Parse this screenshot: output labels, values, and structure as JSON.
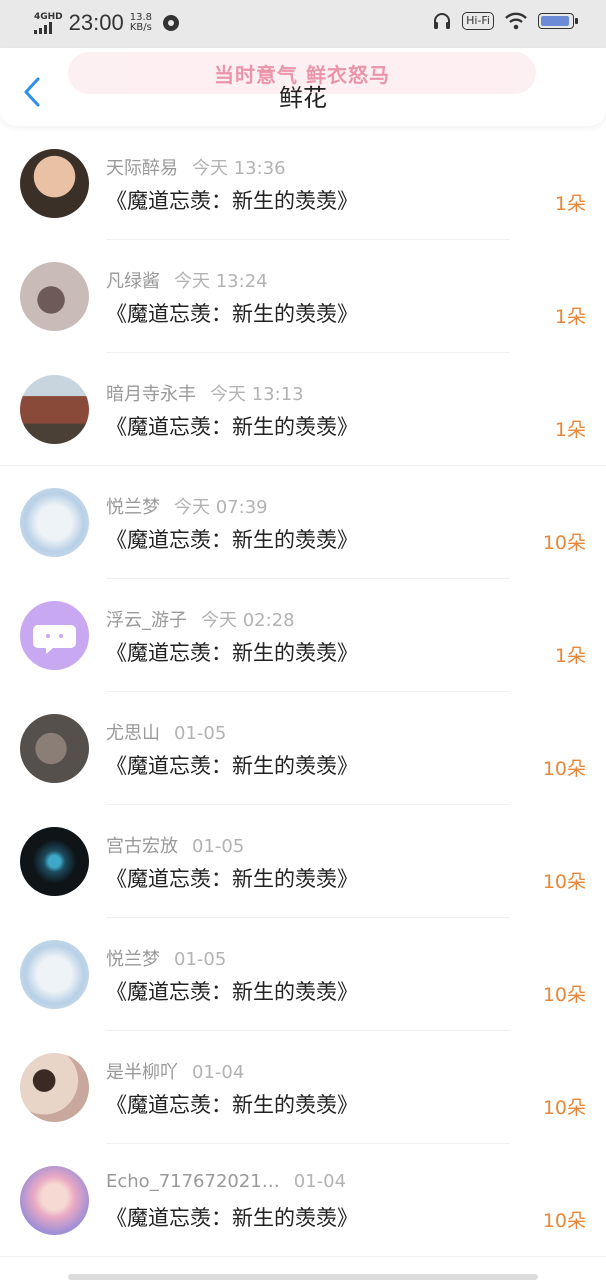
{
  "status": {
    "network": "4GHD",
    "time": "23:00",
    "speed_value": "13.8",
    "speed_unit": "KB/s",
    "hifi": "Hi-Fi"
  },
  "header": {
    "banner": "当时意气 鲜衣怒马",
    "title": "鲜花"
  },
  "items": [
    {
      "user": "天际醉易",
      "time": "今天 13:36",
      "book": "《魔道忘羡：新生的羡羡》",
      "count": "1朵",
      "avatar_color": "#3a3028"
    },
    {
      "user": "凡绿酱",
      "time": "今天 13:24",
      "book": "《魔道忘羡：新生的羡羡》",
      "count": "1朵",
      "avatar_color": "#b9aaa4"
    },
    {
      "user": "暗月寺永丰",
      "time": "今天 13:13",
      "book": "《魔道忘羡：新生的羡羡》",
      "count": "1朵",
      "avatar_color": "#8a4a3a"
    },
    {
      "user": "悦兰梦",
      "time": "今天 07:39",
      "book": "《魔道忘羡：新生的羡羡》",
      "count": "10朵",
      "avatar_color": "#c9dcec"
    },
    {
      "user": "浮云_游子",
      "time": "今天 02:28",
      "book": "《魔道忘羡：新生的羡羡》",
      "count": "1朵",
      "avatar_color": "#c9a8f2"
    },
    {
      "user": "尤思山",
      "time": "01-05",
      "book": "《魔道忘羡：新生的羡羡》",
      "count": "10朵",
      "avatar_color": "#6b625c"
    },
    {
      "user": "宫古宏放",
      "time": "01-05",
      "book": "《魔道忘羡：新生的羡羡》",
      "count": "10朵",
      "avatar_color": "#0e1418"
    },
    {
      "user": "悦兰梦",
      "time": "01-05",
      "book": "《魔道忘羡：新生的羡羡》",
      "count": "10朵",
      "avatar_color": "#c9dcec"
    },
    {
      "user": "是半柳吖",
      "time": "01-04",
      "book": "《魔道忘羡：新生的羡羡》",
      "count": "10朵",
      "avatar_color": "#c8a89c"
    },
    {
      "user": "Echo_717672021…",
      "time": "01-04",
      "book": "《魔道忘羡：新生的羡羡》",
      "count": "10朵",
      "avatar_color": "#9f8fd6"
    }
  ]
}
